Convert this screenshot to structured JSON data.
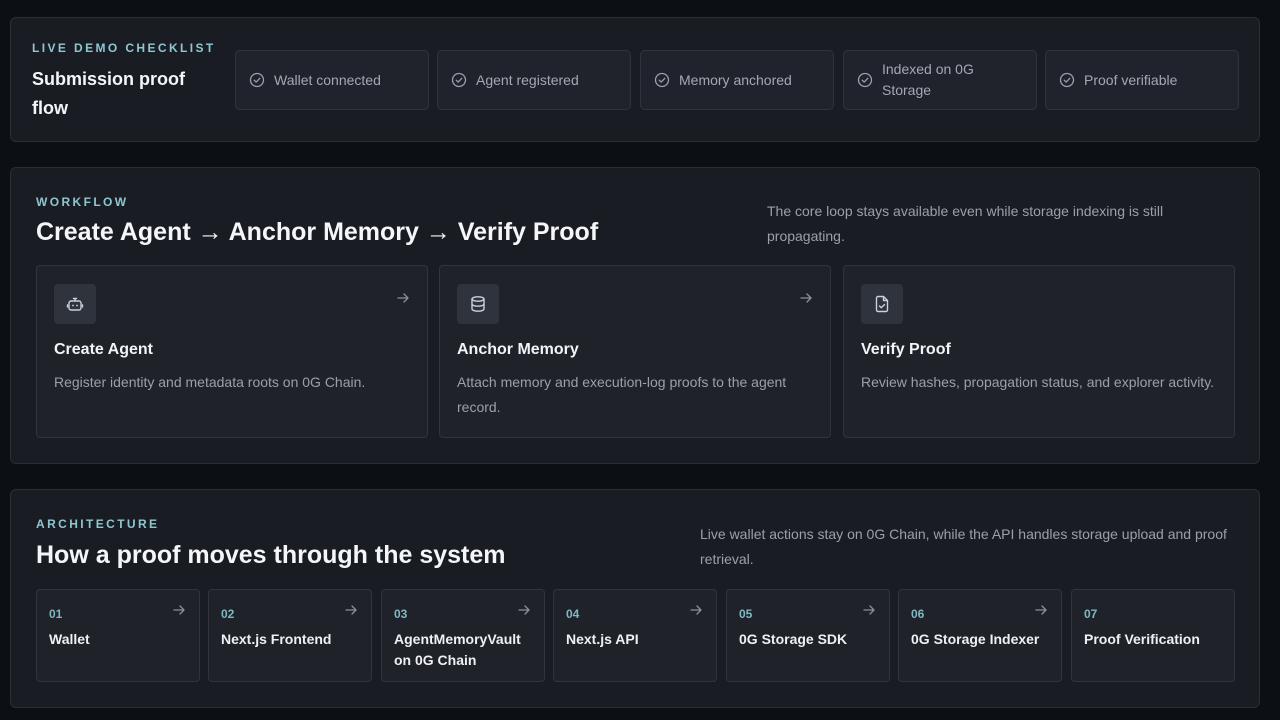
{
  "checklist": {
    "eyebrow": "LIVE DEMO CHECKLIST",
    "title": "Submission proof flow",
    "items": [
      {
        "label": "Wallet connected",
        "icon": "check-circle-icon"
      },
      {
        "label": "Agent registered",
        "icon": "check-circle-icon"
      },
      {
        "label": "Memory anchored",
        "icon": "check-circle-icon"
      },
      {
        "label": "Indexed on 0G Storage",
        "icon": "check-circle-icon"
      },
      {
        "label": "Proof verifiable",
        "icon": "check-circle-icon"
      }
    ]
  },
  "workflow": {
    "eyebrow": "WORKFLOW",
    "title": "Create Agent → Anchor Memory → Verify Proof",
    "description": "The core loop stays available even while storage indexing is still propagating.",
    "cards": [
      {
        "title": "Create Agent",
        "description": "Register identity and metadata roots on 0G Chain.",
        "icon": "bot-icon"
      },
      {
        "title": "Anchor Memory",
        "description": "Attach memory and execution-log proofs to the agent record.",
        "icon": "database-icon"
      },
      {
        "title": "Verify Proof",
        "description": "Review hashes, propagation status, and explorer activity.",
        "icon": "file-check-icon"
      }
    ]
  },
  "architecture": {
    "eyebrow": "ARCHITECTURE",
    "title": "How a proof moves through the system",
    "description": "Live wallet actions stay on 0G Chain, while the API handles storage upload and proof retrieval.",
    "steps": [
      {
        "number": "01",
        "label": "Wallet"
      },
      {
        "number": "02",
        "label": "Next.js Frontend"
      },
      {
        "number": "03",
        "label": "AgentMemoryVault on 0G Chain"
      },
      {
        "number": "04",
        "label": "Next.js API"
      },
      {
        "number": "05",
        "label": "0G Storage SDK"
      },
      {
        "number": "06",
        "label": "0G Storage Indexer"
      },
      {
        "number": "07",
        "label": "Proof Verification"
      }
    ]
  },
  "colors": {
    "background": "#0c0f14",
    "panel": "#191c23",
    "card": "#1f2229",
    "accent": "#8fc7d1",
    "text_primary": "#f4f6f9",
    "text_secondary": "#9aa0ab"
  }
}
